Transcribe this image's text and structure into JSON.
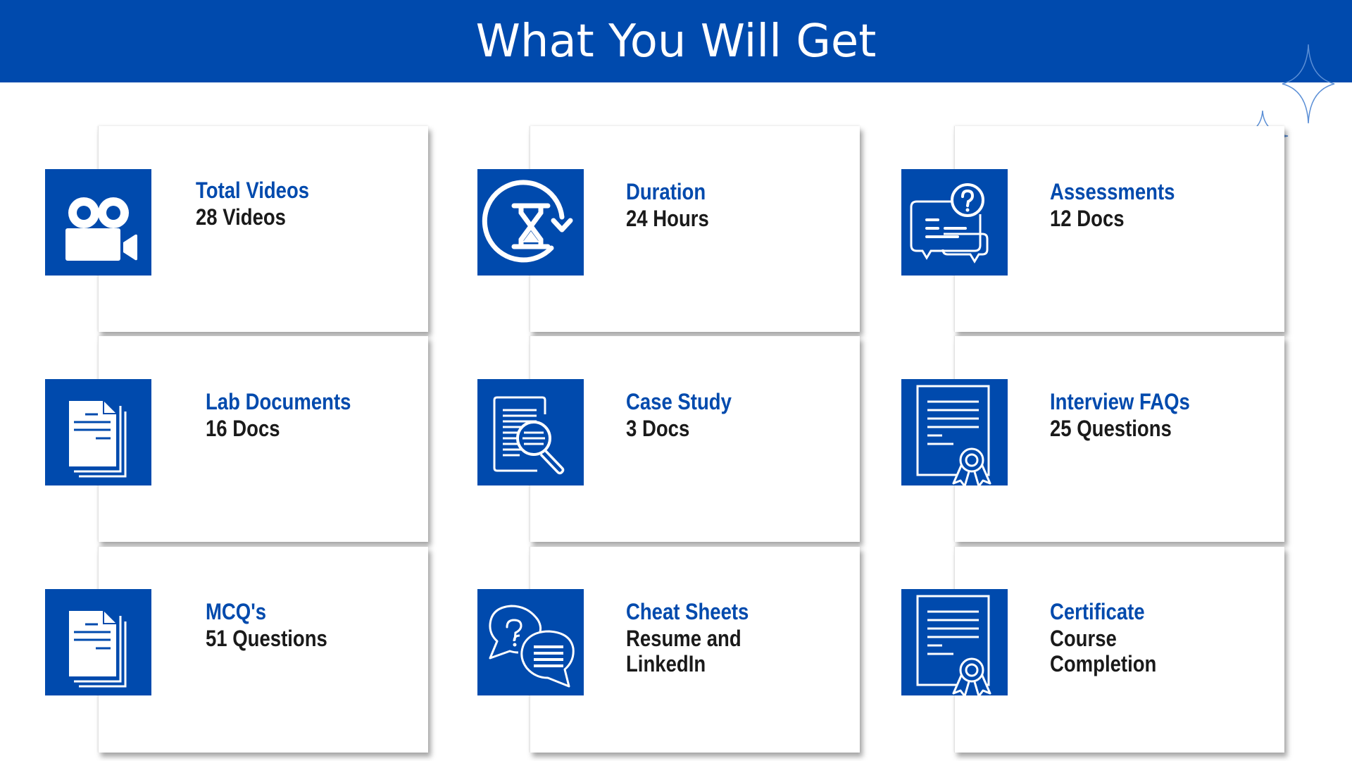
{
  "header": {
    "title": "What You Will Get"
  },
  "colors": {
    "brand_blue": "#004aad",
    "value_text": "#1a1a1a",
    "card_bg": "#ffffff"
  },
  "items": [
    {
      "title": "Total Videos",
      "value": "28 Videos",
      "icon": "video-camera-icon"
    },
    {
      "title": "Duration",
      "value": "24 Hours",
      "icon": "hourglass-refresh-icon"
    },
    {
      "title": "Assessments",
      "value": "12 Docs",
      "icon": "question-chat-icon"
    },
    {
      "title": "Lab Documents",
      "value": "16 Docs",
      "icon": "documents-stack-icon"
    },
    {
      "title": "Case Study",
      "value": "3 Docs",
      "icon": "document-search-icon"
    },
    {
      "title": "Interview FAQs",
      "value": "25 Questions",
      "icon": "certificate-icon"
    },
    {
      "title": "MCQ's",
      "value": "51 Questions",
      "icon": "documents-stack-icon"
    },
    {
      "title": "Cheat Sheets",
      "value": "Resume and\nLinkedIn",
      "icon": "chat-bubbles-icon"
    },
    {
      "title": "Certificate",
      "value": "Course Completion",
      "icon": "certificate-icon"
    }
  ]
}
